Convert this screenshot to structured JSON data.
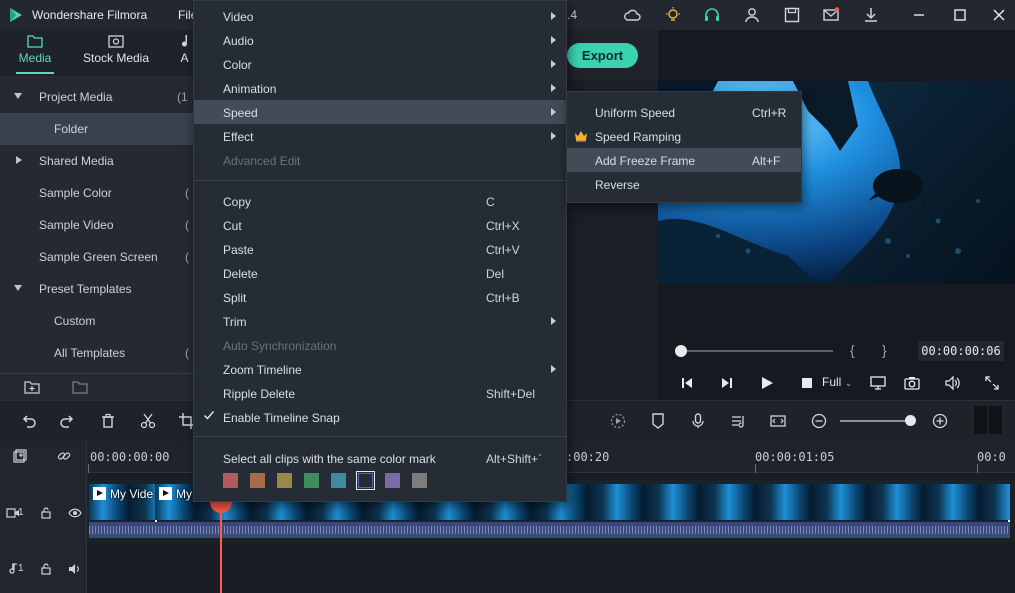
{
  "app": {
    "title": "Wondershare Filmora",
    "menu_file": "File",
    "project_fragment": ".4"
  },
  "media_panel": {
    "tabs": [
      {
        "label": "Media",
        "icon": "folder-icon",
        "active": true
      },
      {
        "label": "Stock Media",
        "icon": "stock-media-icon",
        "active": false
      },
      {
        "label": "A",
        "icon": "audio-icon",
        "active": false
      }
    ],
    "tree": [
      {
        "label": "Project Media",
        "count": "(1",
        "expanded": true
      },
      {
        "label": "Folder",
        "count": "",
        "selected": true
      },
      {
        "label": "Shared Media",
        "count": "",
        "expanded": false
      },
      {
        "label": "Sample Color",
        "count": "(",
        "expanded": null
      },
      {
        "label": "Sample Video",
        "count": "(",
        "expanded": null
      },
      {
        "label": "Sample Green Screen",
        "count": "(",
        "expanded": null
      },
      {
        "label": "Preset Templates",
        "count": "",
        "expanded": true
      },
      {
        "label": "Custom",
        "count": ""
      },
      {
        "label": "All Templates",
        "count": "("
      }
    ]
  },
  "preview": {
    "export_label": "Export",
    "timecode": "00:00:00:06",
    "quality": "Full",
    "bracket_in": "{",
    "bracket_out": "}"
  },
  "context_menu": {
    "groups": [
      [
        {
          "label": "Video",
          "shortcut": "",
          "submenu": true
        },
        {
          "label": "Audio",
          "shortcut": "",
          "submenu": true
        },
        {
          "label": "Color",
          "shortcut": "",
          "submenu": true
        },
        {
          "label": "Animation",
          "shortcut": "",
          "submenu": true
        },
        {
          "label": "Speed",
          "shortcut": "",
          "submenu": true,
          "highlighted": true
        },
        {
          "label": "Effect",
          "shortcut": "",
          "submenu": true
        },
        {
          "label": "Advanced Edit",
          "shortcut": "",
          "disabled": true
        }
      ],
      [
        {
          "label": "Copy",
          "shortcut": "C"
        },
        {
          "label": "Cut",
          "shortcut": "Ctrl+X"
        },
        {
          "label": "Paste",
          "shortcut": "Ctrl+V"
        },
        {
          "label": "Delete",
          "shortcut": "Del"
        },
        {
          "label": "Split",
          "shortcut": "Ctrl+B"
        },
        {
          "label": "Trim",
          "shortcut": "",
          "submenu": true
        },
        {
          "label": "Auto Synchronization",
          "shortcut": "",
          "disabled": true
        },
        {
          "label": "Zoom Timeline",
          "shortcut": "",
          "submenu": true
        },
        {
          "label": "Ripple Delete",
          "shortcut": "Shift+Del"
        },
        {
          "label": "Enable Timeline Snap",
          "shortcut": "",
          "checked": true
        }
      ],
      [
        {
          "label": "Select all clips with the same color mark",
          "shortcut": "Alt+Shift+`"
        }
      ]
    ],
    "color_marks": [
      "#b35a5a",
      "#a86a4c",
      "#9a8848",
      "#3f8c5f",
      "#3e8aa1",
      "#5a66a8",
      "#7a6aa8",
      "#7d7d7d"
    ],
    "selected_color_index": 5
  },
  "speed_submenu": {
    "items": [
      {
        "label": "Uniform Speed",
        "shortcut": "Ctrl+R"
      },
      {
        "label": "Speed Ramping",
        "shortcut": "",
        "icon": "crown-icon"
      },
      {
        "label": "Add Freeze Frame",
        "shortcut": "Alt+F",
        "highlighted": true
      },
      {
        "label": "Reverse",
        "shortcut": ""
      }
    ]
  },
  "timeline": {
    "ruler_labels": [
      "00:00:00:00",
      ":00:20",
      "00:00:01:05",
      "00:0"
    ],
    "clips": [
      {
        "title": "My Vide"
      },
      {
        "title": "My"
      }
    ],
    "tracks": {
      "video_number": "1",
      "audio_number": "1"
    }
  },
  "colors": {
    "accent": "#3ad2b1",
    "playhead": "#ff5a4a",
    "menu_bg": "#262c35",
    "menu_highlight": "#434b57"
  }
}
